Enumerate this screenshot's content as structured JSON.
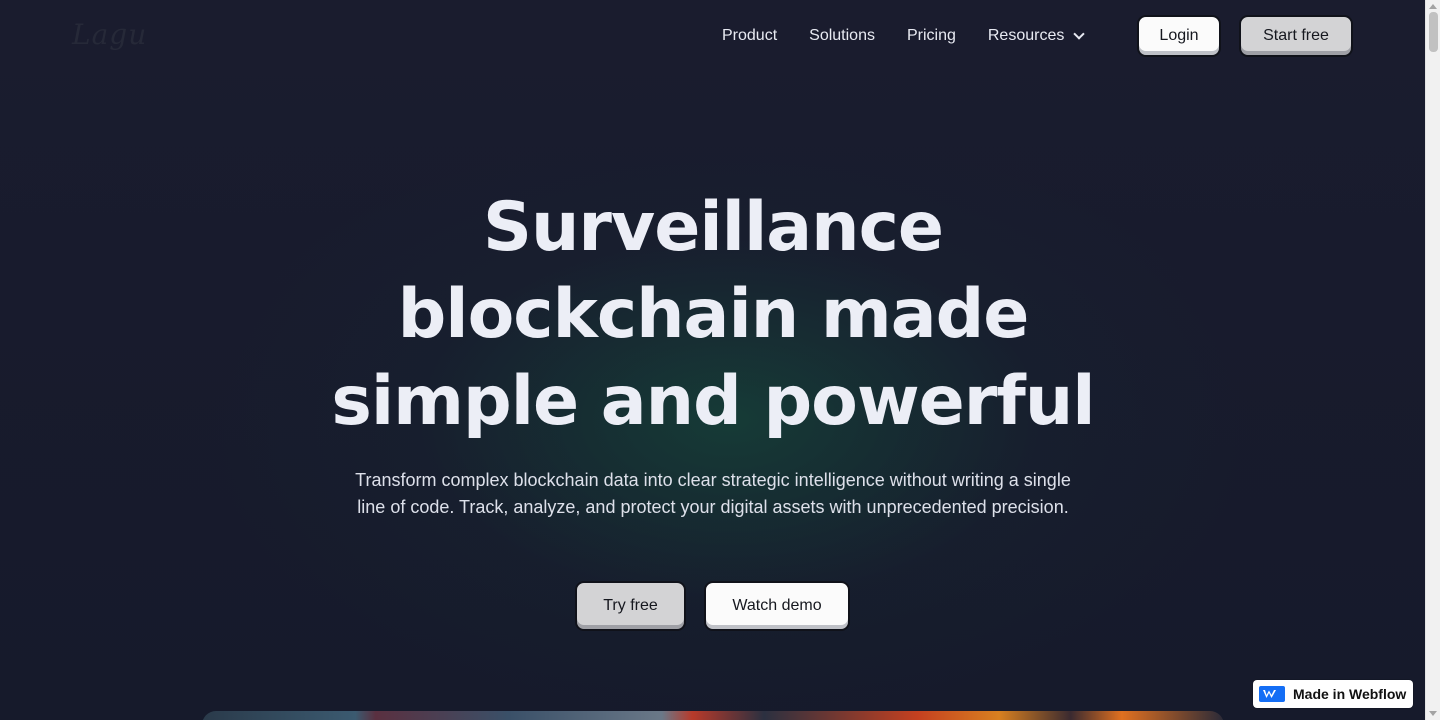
{
  "brand": {
    "logo_text": "Lagu"
  },
  "nav": {
    "items": [
      {
        "label": "Product"
      },
      {
        "label": "Solutions"
      },
      {
        "label": "Pricing"
      },
      {
        "label": "Resources"
      }
    ],
    "login_label": "Login",
    "start_label": "Start free"
  },
  "hero": {
    "title_line1": "Surveillance",
    "title_line2": "blockchain made",
    "title_line3": "simple and powerful",
    "subtitle": "Transform complex blockchain data into clear strategic intelligence without writing a single line of code. Track, analyze, and protect your digital assets with unprecedented precision.",
    "primary_cta": "Try free",
    "secondary_cta": "Watch demo"
  },
  "badge": {
    "label": "Made in Webflow",
    "color": "#146ef5"
  },
  "colors": {
    "background": "#181b2d",
    "glow": "#16463a"
  }
}
